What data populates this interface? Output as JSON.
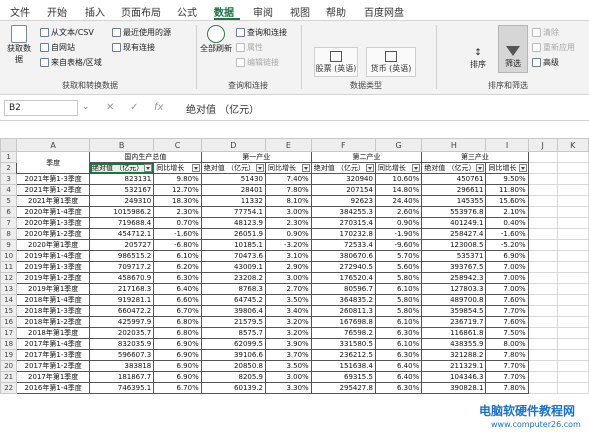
{
  "tabs": [
    {
      "label": "文件",
      "active": false
    },
    {
      "label": "开始",
      "active": false
    },
    {
      "label": "插入",
      "active": false
    },
    {
      "label": "页面布局",
      "active": false
    },
    {
      "label": "公式",
      "active": false
    },
    {
      "label": "数据",
      "active": true
    },
    {
      "label": "审阅",
      "active": false
    },
    {
      "label": "视图",
      "active": false
    },
    {
      "label": "帮助",
      "active": false
    },
    {
      "label": "百度网盘",
      "active": false
    }
  ],
  "ribbon": {
    "get_data": {
      "line1": "获取数",
      "line2": "据"
    },
    "from_text_csv": "从文本/CSV",
    "from_web": "自网站",
    "from_table": "来自表格/区域",
    "recent_sources": "最近使用的源",
    "existing_connections": "现有连接",
    "group1_label": "获取和转换数据",
    "refresh_all": {
      "line1": "全部刷新",
      "line2": ""
    },
    "queries_connections": "查询和连接",
    "properties": "属性",
    "edit_links": "编辑链接",
    "group2_label": "查询和连接",
    "data_types": [
      "股票 (英语)",
      "货币 (英语)"
    ],
    "group3_label": "数据类型",
    "sort": "排序",
    "filter": "筛选",
    "clear": "清除",
    "reapply": "重新应用",
    "advanced": "高级",
    "group4_label": "排序和筛选"
  },
  "formula_bar": {
    "name_box": "B2",
    "cancel": "✕",
    "enter": "✓",
    "fx": "fx",
    "content": "绝对值 （亿元）"
  },
  "sheet": {
    "columns": [
      "A",
      "B",
      "C",
      "D",
      "E",
      "F",
      "G",
      "H",
      "I",
      "J",
      "K"
    ],
    "header": {
      "season": "季度",
      "groups": [
        "国内生产总值",
        "第一产业",
        "第二产业",
        "第三产业"
      ],
      "abs_label": "绝对值 （亿元）",
      "yoy_label": "同比增长"
    },
    "rows": [
      [
        "2021年第1-3季度",
        "823131",
        "9.80%",
        "51430",
        "7.40%",
        "320940",
        "10.60%",
        "450761",
        "9.50%"
      ],
      [
        "2021年第1-2季度",
        "532167",
        "12.70%",
        "28401",
        "7.80%",
        "207154",
        "14.80%",
        "296611",
        "11.80%"
      ],
      [
        "2021年第1季度",
        "249310",
        "18.30%",
        "11332",
        "8.10%",
        "92623",
        "24.40%",
        "145355",
        "15.60%"
      ],
      [
        "2020年第1-4季度",
        "1015986.2",
        "2.30%",
        "77754.1",
        "3.00%",
        "384255.3",
        "2.60%",
        "553976.8",
        "2.10%"
      ],
      [
        "2020年第1-3季度",
        "719688.4",
        "0.70%",
        "48123.9",
        "2.30%",
        "270315.4",
        "0.90%",
        "401249.1",
        "0.40%"
      ],
      [
        "2020年第1-2季度",
        "454712.1",
        "-1.60%",
        "26051.9",
        "0.90%",
        "170232.8",
        "-1.90%",
        "258427.4",
        "-1.60%"
      ],
      [
        "2020年第1季度",
        "205727",
        "-6.80%",
        "10185.1",
        "-3.20%",
        "72533.4",
        "-9.60%",
        "123008.5",
        "-5.20%"
      ],
      [
        "2019年第1-4季度",
        "986515.2",
        "6.10%",
        "70473.6",
        "3.10%",
        "380670.6",
        "5.70%",
        "535371",
        "6.90%"
      ],
      [
        "2019年第1-3季度",
        "709717.2",
        "6.20%",
        "43009.1",
        "2.90%",
        "272940.5",
        "5.60%",
        "393767.5",
        "7.00%"
      ],
      [
        "2019年第1-2季度",
        "458670.9",
        "6.30%",
        "23208.2",
        "3.00%",
        "176520.4",
        "5.80%",
        "258942.3",
        "7.00%"
      ],
      [
        "2019年第1季度",
        "217168.3",
        "6.40%",
        "8768.3",
        "2.70%",
        "80596.7",
        "6.10%",
        "127803.3",
        "7.00%"
      ],
      [
        "2018年第1-4季度",
        "919281.1",
        "6.60%",
        "64745.2",
        "3.50%",
        "364835.2",
        "5.80%",
        "489700.8",
        "7.60%"
      ],
      [
        "2018年第1-3季度",
        "660472.2",
        "6.70%",
        "39806.4",
        "3.40%",
        "260811.3",
        "5.80%",
        "359854.5",
        "7.70%"
      ],
      [
        "2018年第1-2季度",
        "425997.9",
        "6.80%",
        "21579.5",
        "3.20%",
        "167698.8",
        "6.10%",
        "236719.7",
        "7.60%"
      ],
      [
        "2018年第1季度",
        "202035.7",
        "6.80%",
        "8575.7",
        "3.20%",
        "76598.2",
        "6.30%",
        "116861.8",
        "7.50%"
      ],
      [
        "2017年第1-4季度",
        "832035.9",
        "6.90%",
        "62099.5",
        "3.90%",
        "331580.5",
        "6.10%",
        "438355.9",
        "8.00%"
      ],
      [
        "2017年第1-3季度",
        "596607.3",
        "6.90%",
        "39106.6",
        "3.70%",
        "236212.5",
        "6.30%",
        "321288.2",
        "7.80%"
      ],
      [
        "2017年第1-2季度",
        "383818",
        "6.90%",
        "20850.8",
        "3.50%",
        "151638.4",
        "6.40%",
        "211329.1",
        "7.70%"
      ],
      [
        "2017年第1季度",
        "181867.7",
        "6.90%",
        "8205.9",
        "3.00%",
        "69315.5",
        "6.40%",
        "104346.3",
        "7.70%"
      ],
      [
        "2016年第1-4季度",
        "746395.1",
        "6.70%",
        "60139.2",
        "3.30%",
        "295427.8",
        "6.30%",
        "390828.1",
        "7.80%"
      ]
    ]
  },
  "watermark": {
    "title": "电脑软硬件教程网",
    "url": "www.computer26.com"
  },
  "colors": {
    "accent": "#217346",
    "watermark": "#1a73c7"
  }
}
